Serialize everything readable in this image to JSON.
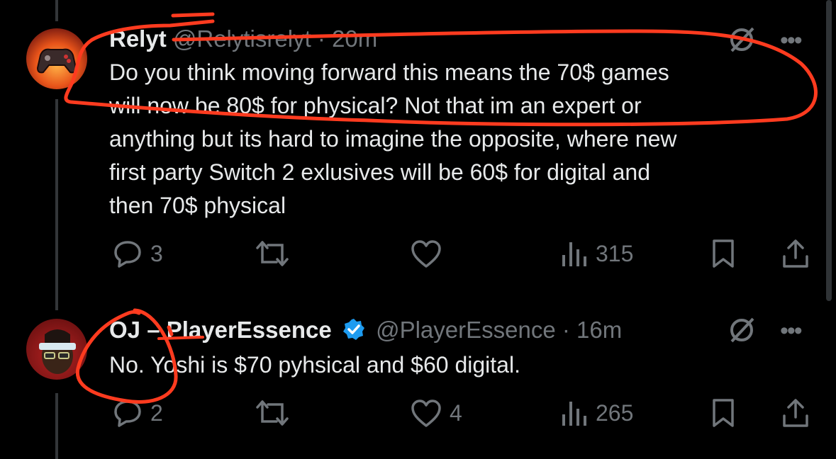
{
  "tweets": [
    {
      "display_name": "Relyt",
      "handle": "@Relytisrelyt",
      "time": "· 20m",
      "text": "Do you think moving forward this means the 70$ games\nwill now be 80$ for physical? Not that im an expert or\nanything but its hard to imagine the opposite, where new\nfirst party Switch 2 exlusives will be 60$ for digital and\nthen 70$ physical",
      "replies": "3",
      "reposts": "",
      "likes": "",
      "views": "315"
    },
    {
      "display_name": "OJ – PlayerEssence",
      "handle": "@PlayerEssence",
      "time": "· 16m",
      "text": "No. Yoshi is $70 pyhsical and $60 digital.",
      "replies": "2",
      "reposts": "",
      "likes": "4",
      "views": "265"
    }
  ],
  "more_label": "•••",
  "colors": {
    "background": "#000000",
    "text": "#e7e9ea",
    "muted": "#71767b",
    "verified": "#1d9bf0",
    "annotation": "#ff3b1f"
  },
  "icons": [
    "reply-icon",
    "repost-icon",
    "like-icon",
    "views-icon",
    "bookmark-icon",
    "share-icon",
    "grok-icon",
    "verified-badge-icon"
  ]
}
